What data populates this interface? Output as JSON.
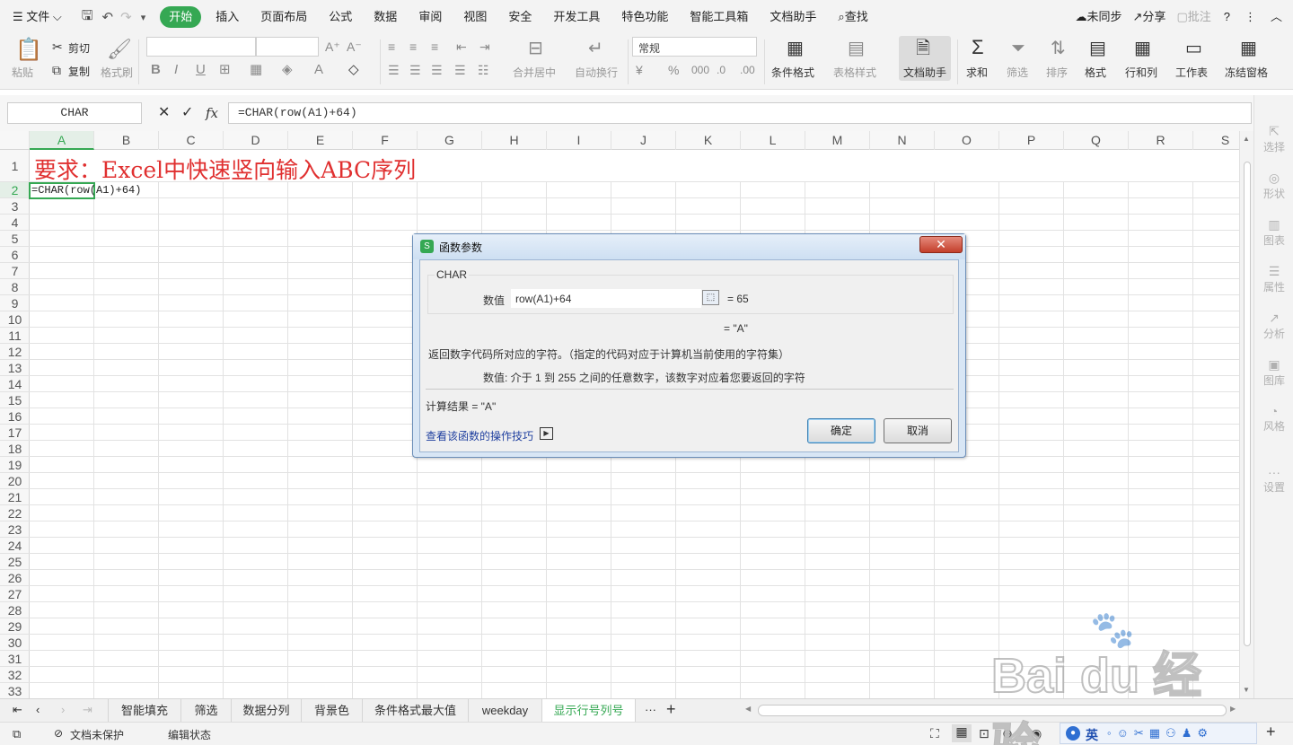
{
  "menubar": {
    "file": "文件",
    "items": [
      "开始",
      "插入",
      "页面布局",
      "公式",
      "数据",
      "审阅",
      "视图",
      "安全",
      "开发工具",
      "特色功能",
      "智能工具箱",
      "文档助手"
    ],
    "search": "查找",
    "sync": "未同步",
    "share": "分享",
    "annotate": "批注"
  },
  "ribbon": {
    "paste": "粘贴",
    "cut": "剪切",
    "copy": "复制",
    "format_painter": "格式刷",
    "merge_center": "合并居中",
    "wrap_text": "自动换行",
    "number_format": "常规",
    "conditional_format": "条件格式",
    "table_style": "表格样式",
    "doc_assistant": "文档助手",
    "sum": "求和",
    "filter": "筛选",
    "sort": "排序",
    "format": "格式",
    "row_col": "行和列",
    "worksheet": "工作表",
    "freeze": "冻结窗格"
  },
  "formula_bar": {
    "name_box": "CHAR",
    "formula": "=CHAR(row(A1)+64)",
    "fx": "fx"
  },
  "columns": [
    "A",
    "B",
    "C",
    "D",
    "E",
    "F",
    "G",
    "H",
    "I",
    "J",
    "K",
    "L",
    "M",
    "N",
    "O",
    "P",
    "Q",
    "R",
    "S"
  ],
  "rows": [
    "1",
    "2",
    "3",
    "4",
    "5",
    "6",
    "7",
    "8",
    "9",
    "10",
    "11",
    "12",
    "13",
    "14",
    "15",
    "16",
    "17",
    "18",
    "19",
    "20",
    "21",
    "22",
    "23",
    "24",
    "25",
    "26",
    "27",
    "28",
    "29",
    "30",
    "31",
    "32",
    "33"
  ],
  "cells": {
    "a1": "要求：Excel中快速竖向输入ABC序列",
    "a2": "=CHAR(row(A1)+64)"
  },
  "dialog": {
    "title": "函数参数",
    "function_name": "CHAR",
    "arg_label": "数值",
    "arg_value": "row(A1)+64",
    "arg_result": "= 65",
    "func_result": "= \"A\"",
    "description": "返回数字代码所对应的字符。（指定的代码对应于计算机当前使用的字符集）",
    "arg_description": "数值:  介于 1 到 255 之间的任意数字，该数字对应着您要返回的字符",
    "calc_result": "计算结果  =  \"A\"",
    "help_link": "查看该函数的操作技巧",
    "ok": "确定",
    "cancel": "取消"
  },
  "sheets": [
    "智能填充",
    "筛选",
    "数据分列",
    "背景色",
    "条件格式最大值",
    "weekday",
    "显示行号列号"
  ],
  "side_panel": [
    "选择",
    "形状",
    "图表",
    "属性",
    "分析",
    "图库",
    "风格",
    "设置"
  ],
  "status": {
    "protect": "文档未保护",
    "edit_state": "编辑状态",
    "ime": "英"
  },
  "colors": {
    "accent": "#35a853",
    "title_red": "#e03030",
    "link": "#1f3f9f"
  }
}
